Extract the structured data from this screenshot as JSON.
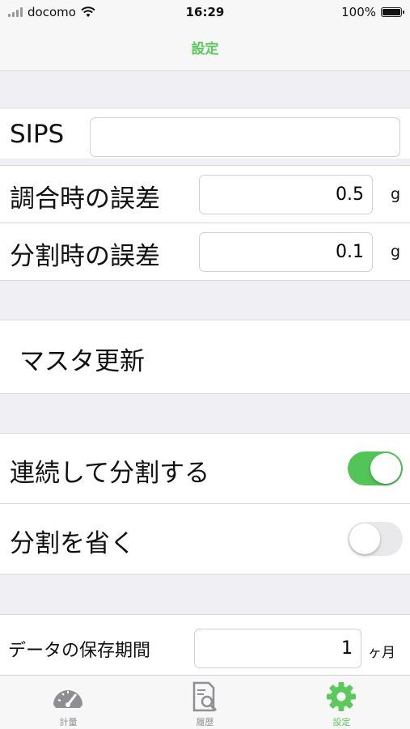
{
  "status_bar": {
    "carrier": "docomo",
    "time": "16:29",
    "battery": "100%",
    "battery_level": 1.0
  },
  "nav": {
    "title": "設定"
  },
  "sips": {
    "label": "SIPS",
    "value": ""
  },
  "mix_error": {
    "label": "調合時の誤差",
    "value": "0.5",
    "unit": "g"
  },
  "split_error": {
    "label": "分割時の誤差",
    "value": "0.1",
    "unit": "g"
  },
  "master_update": {
    "label": "マスタ更新"
  },
  "continuous_split": {
    "label": "連続して分割する",
    "enabled": true
  },
  "omit_split": {
    "label": "分割を省く",
    "enabled": false
  },
  "retention": {
    "label": "データの保存期間",
    "value": "1",
    "unit": "ヶ月"
  },
  "tabs": [
    {
      "label": "計量",
      "icon": "gauge-icon",
      "active": false
    },
    {
      "label": "履歴",
      "icon": "history-icon",
      "active": false
    },
    {
      "label": "設定",
      "icon": "gear-icon",
      "active": true
    }
  ],
  "colors": {
    "accent": "#5cc95c",
    "toggle_on": "#53c458",
    "background": "#efeff4"
  }
}
